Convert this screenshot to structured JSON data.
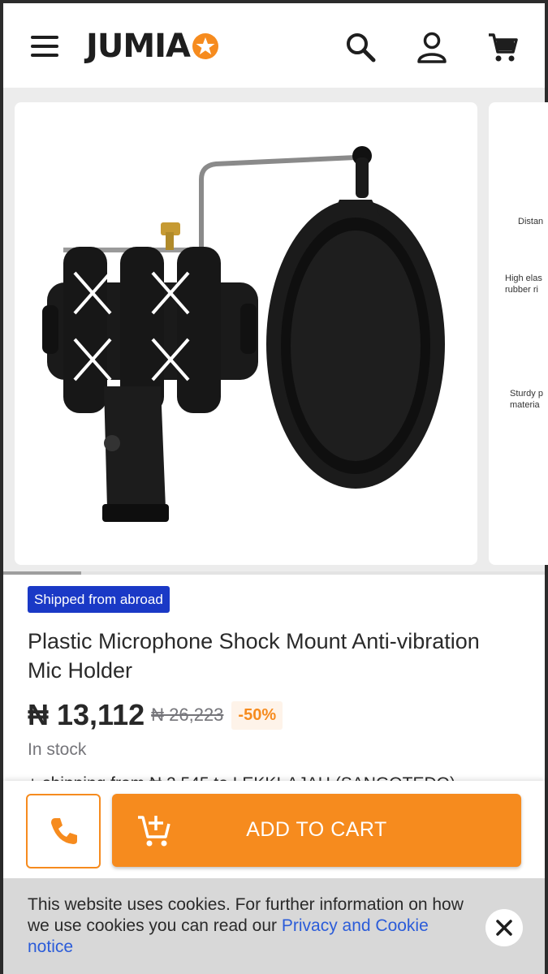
{
  "header": {
    "logo_text": "JUMIA",
    "icons": [
      "menu-icon",
      "search-icon",
      "account-icon",
      "cart-icon"
    ],
    "brand_color": "#f68b1e"
  },
  "gallery": {
    "peek_labels": [
      "Distan",
      "High elas\nrubber ri",
      "Sturdy p\nmateria"
    ],
    "scroll_position": 0.14
  },
  "product": {
    "badge": "Shipped from abroad",
    "title": "Plastic Microphone Shock Mount Anti-vibration Mic Holder",
    "price": "₦ 13,112",
    "old_price": "₦ 26,223",
    "discount": "-50%",
    "stock": "In stock",
    "shipping": "+ shipping from ₦ 2,545 to LEKKI-AJAH (SANGOTEDO)"
  },
  "actions": {
    "call_icon": "phone-icon",
    "add_to_cart_label": "ADD TO CART",
    "accent_color": "#f68b1e"
  },
  "cookie_banner": {
    "text": "This website uses cookies. For further information on how we use cookies you can read our ",
    "link_text": "Privacy and Cookie notice",
    "close_icon": "close-icon"
  }
}
